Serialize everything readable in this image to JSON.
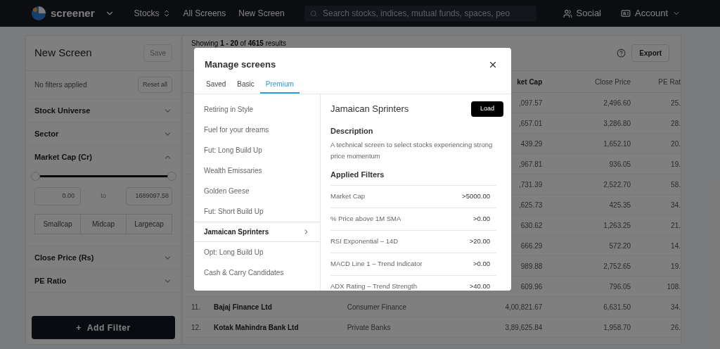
{
  "navbar": {
    "brand": "screener",
    "links": [
      {
        "label": "Stocks",
        "kind": "sort"
      },
      {
        "label": "All Screens",
        "kind": "plain"
      },
      {
        "label": "New Screen",
        "kind": "plain"
      }
    ],
    "search": {
      "placeholder": "Search stocks, indices, mutual funds, spaces, peo"
    },
    "social": "Social",
    "account": "Account"
  },
  "filter_panel": {
    "title": "New Screen",
    "save": {
      "label": "Save",
      "disabled": true
    },
    "status": "No filters applied",
    "reset": "Reset all",
    "sections": [
      {
        "label": "Stock Universe",
        "expanded": false
      },
      {
        "label": "Sector",
        "expanded": false
      },
      {
        "label": "Market Cap (Cr)",
        "expanded": true,
        "range": {
          "level": 1,
          "min": "0.00",
          "separator": "to",
          "max": "1689097.58"
        },
        "presets": [
          "Smallcap",
          "Midcap",
          "Largecap"
        ]
      },
      {
        "label": "Close Price (Rs)",
        "expanded": false
      },
      {
        "label": "PE Ratio",
        "expanded": false
      }
    ],
    "add_filter": {
      "icon": "+",
      "label": "Add Filter"
    }
  },
  "results": {
    "summary": "Showing **1 - 20** of **4615** results",
    "export": "Export",
    "columns": [
      "ket Cap",
      "Close Price",
      "PE Rat"
    ],
    "rows": [
      {
        "market_cap": ",097.57",
        "close_price": "2,496.60",
        "pe_ratio": "25."
      },
      {
        "market_cap": ",657.01",
        "close_price": "3,286.80",
        "pe_ratio": "28."
      },
      {
        "market_cap": "439.29",
        "close_price": "1,652.10",
        "pe_ratio": "20."
      },
      {
        "market_cap": ",967.81",
        "close_price": "936.05",
        "pe_ratio": "19."
      },
      {
        "market_cap": ",731.39",
        "close_price": "2,522.70",
        "pe_ratio": "58."
      },
      {
        "market_cap": ",625.73",
        "close_price": "425.35",
        "pe_ratio": "34."
      },
      {
        "market_cap": "630.62",
        "close_price": "1,263.25",
        "pe_ratio": "21."
      },
      {
        "market_cap": "666.29",
        "close_price": "572.20",
        "pe_ratio": "14."
      },
      {
        "market_cap": "989.88",
        "close_price": "2,752.65",
        "pe_ratio": "19."
      },
      {
        "market_cap": "609.96",
        "close_price": "796.05",
        "pe_ratio": "108."
      },
      {
        "number": "11.",
        "name": "Bajaj Finance Ltd",
        "industry": "Consumer Finance",
        "market_cap": "4,00,821.67",
        "close_price": "6,631.50",
        "pe_ratio": "34."
      },
      {
        "number": "12.",
        "name": "Kotak Mahindra Bank Ltd",
        "industry": "Private Banks",
        "market_cap": "3,89,625.84",
        "close_price": "1,958.70",
        "pe_ratio": "26."
      }
    ]
  },
  "modal": {
    "title": "Manage screens",
    "tabs": [
      {
        "label": "Saved",
        "selected": false
      },
      {
        "label": "Basic",
        "selected": false
      },
      {
        "label": "Premium",
        "selected": true
      }
    ],
    "screens": [
      {
        "label": "Retiring in Style",
        "selected": false
      },
      {
        "label": "Fuel for your dreams",
        "selected": false
      },
      {
        "label": "Fut: Long Build Up",
        "selected": false
      },
      {
        "label": "Wealth Emissaries",
        "selected": false
      },
      {
        "label": "Golden Geese",
        "selected": false
      },
      {
        "label": "Fut: Short Build Up",
        "selected": false
      },
      {
        "label": "Jamaican Sprinters",
        "selected": true
      },
      {
        "label": "Opt: Long Build Up",
        "selected": false
      },
      {
        "label": "Cash & Carry Candidates",
        "selected": false
      }
    ],
    "detail": {
      "title": "Jamaican Sprinters",
      "load": "Load",
      "description_heading": "Description",
      "description": "A technical screen to select stocks experiencing strong price momentum",
      "filters_heading": "Applied Filters",
      "filters": [
        {
          "name": "Market Cap",
          "value": ">5000.00"
        },
        {
          "name": "% Price above 1M SMA",
          "value": ">0.00"
        },
        {
          "name": "RSI Exponential – 14D",
          "value": ">20.00"
        },
        {
          "name": "MACD Line 1 – Trend Indicator",
          "value": ">0.00"
        },
        {
          "name": "ADX Rating – Trend Strength",
          "value": ">40.00"
        }
      ]
    }
  }
}
